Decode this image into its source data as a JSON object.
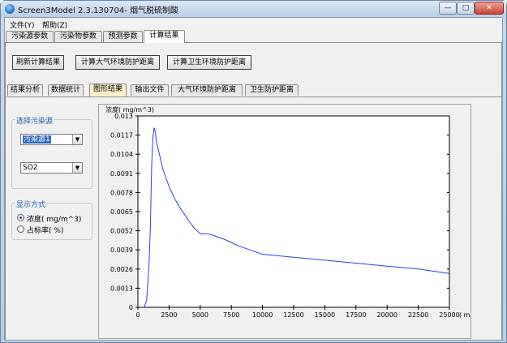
{
  "window": {
    "title": "Screen3Model 2.3.130704- 烟气脱硫制酸",
    "min_glyph": "—",
    "max_glyph": "□",
    "close_glyph": "✕"
  },
  "menu": [
    "文件(Y)",
    "帮助(Z)"
  ],
  "main_tabs": [
    "污染源参数",
    "污染物参数",
    "预测参数",
    "计算结果"
  ],
  "buttons": [
    "刷新计算结果",
    "计算大气环境防护距离",
    "计算卫生环境防护距离"
  ],
  "sub_tabs": [
    "结果分析",
    "数据统计",
    "图形结果",
    "输出文件",
    "大气环境防护距离",
    "卫生防护距离"
  ],
  "source_group": {
    "legend": "选择污染源",
    "source_value": "污染源1",
    "pollutant_value": "SO2"
  },
  "display_group": {
    "legend": "显示方式",
    "options": [
      "浓度( mg/m^3)",
      "占标率( %)"
    ],
    "selected": 0
  },
  "colors": {
    "series": "#2a3fe0",
    "legend_text": "#1c5aa8"
  },
  "chart_data": {
    "type": "line",
    "ylabel": "浓度( mg/m^3)",
    "xlabel": "( m)",
    "xlim": [
      0,
      25000
    ],
    "ylim": [
      0,
      0.013
    ],
    "x_ticks": [
      0,
      2500,
      5000,
      7500,
      10000,
      12500,
      15000,
      17500,
      20000,
      22500,
      25000
    ],
    "y_ticks": [
      "0",
      "0.0013",
      "0.0026",
      "0.0039",
      "0.0052",
      "0.0065",
      "0.0078",
      "0.0091",
      "0.0104",
      "0.0117",
      "0.013"
    ],
    "grid": false,
    "series": [
      {
        "x": [
          500,
          700,
          900,
          1000,
          1100,
          1200,
          1300,
          1400,
          1500,
          1700,
          2000,
          2500,
          3000,
          3500,
          4000,
          4500,
          5000,
          5500,
          6000,
          7000,
          8000,
          9000,
          10000,
          12500,
          15000,
          17500,
          20000,
          22500,
          25000
        ],
        "y": [
          0,
          0.0005,
          0.003,
          0.0055,
          0.0095,
          0.0115,
          0.0122,
          0.0119,
          0.0112,
          0.0105,
          0.0094,
          0.0082,
          0.0073,
          0.0066,
          0.006,
          0.0054,
          0.005,
          0.005,
          0.0049,
          0.0046,
          0.0042,
          0.0039,
          0.0036,
          0.0034,
          0.0032,
          0.003,
          0.0028,
          0.0026,
          0.0023
        ]
      }
    ]
  }
}
